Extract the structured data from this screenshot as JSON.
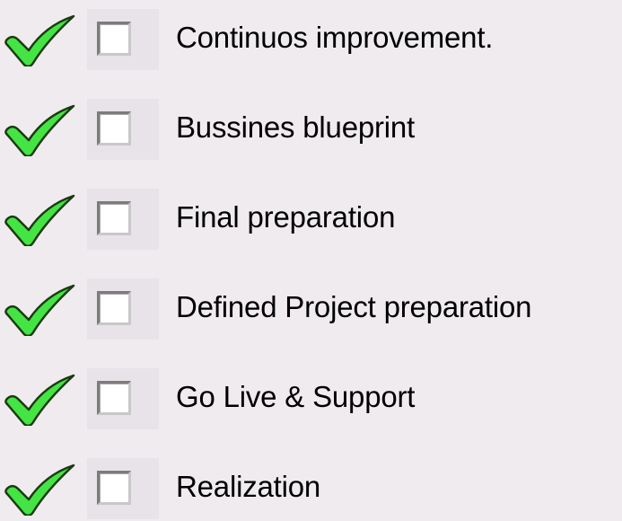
{
  "icons": {
    "check": "check-icon",
    "checkbox": "checkbox"
  },
  "colors": {
    "background": "#efebef",
    "check_fill": "#44e444",
    "check_outline": "#1a3a10"
  },
  "items": [
    {
      "label": "Continuos improvement.",
      "checked": false
    },
    {
      "label": "Bussines blueprint",
      "checked": false
    },
    {
      "label": "Final preparation",
      "checked": false
    },
    {
      "label": "Defined Project preparation",
      "checked": false
    },
    {
      "label": "Go Live & Support",
      "checked": false
    },
    {
      "label": "Realization",
      "checked": false
    }
  ]
}
